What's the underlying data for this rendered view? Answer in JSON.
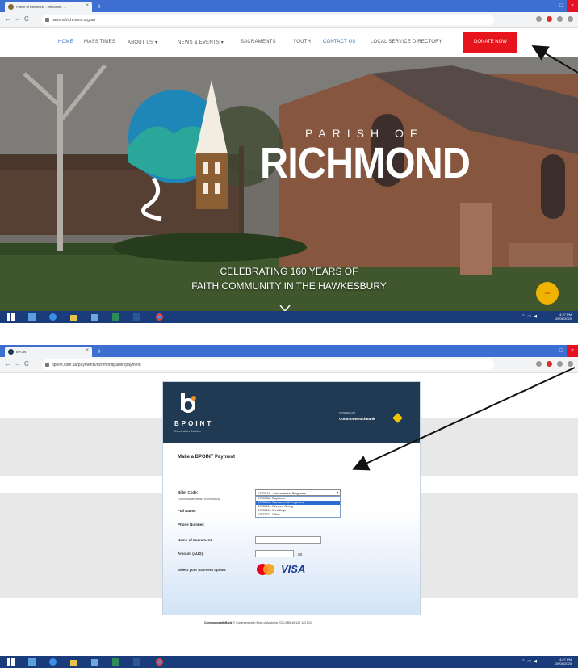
{
  "top": {
    "tab_title": "Parish of Richmond - Welcome - ...",
    "url": "parishofrichmond.org.au",
    "nav": [
      "HOME",
      "MASS TIMES",
      "ABOUT US ▾",
      "NEWS & EVENTS ▾",
      "SACRAMENTS",
      "YOUTH",
      "CONTACT US",
      "LOCAL SERVICE DIRECTORY"
    ],
    "donate_label": "DONATE NOW",
    "parish_label": "PARISH OF",
    "richmond_label": "RICHMOND",
    "caption_line1": "CELEBRATING 160 YEARS OF",
    "caption_line2": "FAITH COMMUNITY IN THE HAWKESBURY",
    "clock_time": "4:27 PM",
    "clock_date": "26/08/2020"
  },
  "bottom": {
    "tab_title": "BPOINT",
    "url": "bpoint.com.au/payments/richmondparish/payment",
    "brand": "BPOINT",
    "brand_sub": "Receivables Solution",
    "powered_by": "POWERED BY",
    "cba": "CommonwealthBank",
    "form_title": "Make a BPOINT Payment",
    "biller_code_label": "Biller Code:",
    "biller_note": "(St Monica/Parish Richmond)",
    "selected_option": "1753344 - Sacramental Programs",
    "options": [
      "1753336 - Baptisms",
      "1753344 - Sacramental Programs",
      "1753351 - Planned Giving",
      "1753369 - Weddings",
      "1753377 - Other"
    ],
    "highlighted_index": 1,
    "full_name_label": "Full Name:",
    "phone_label": "Phone Number:",
    "sacrament_label": "Name of Sacrament:",
    "amount_label": "Amount (AUD):",
    "amount_unit": ".00",
    "payment_option_label": "Select your payment option:",
    "visa": "VISA",
    "footer_brand": "CommonwealthBank",
    "footer_text": "© Commonwealth Bank of Australia 2020 ABN 48 123 123 124",
    "clock_time": "4:27 PM",
    "clock_date": "26/08/2020"
  }
}
